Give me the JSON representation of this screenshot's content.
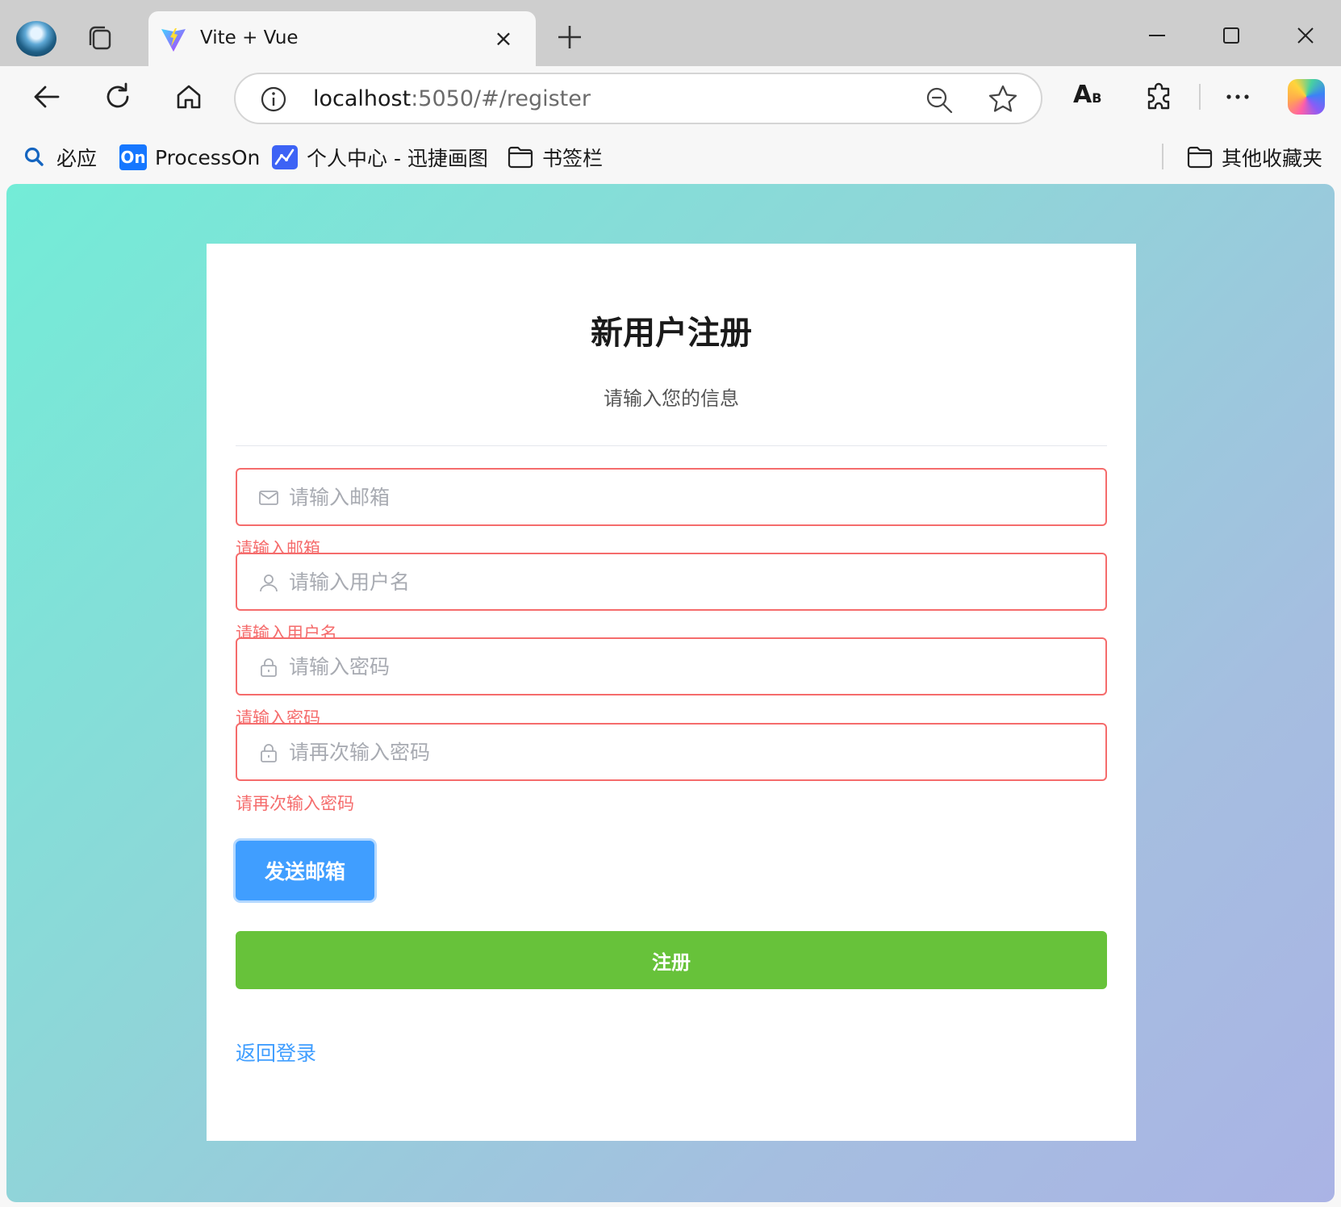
{
  "browser": {
    "tab": {
      "title": "Vite + Vue"
    },
    "address": {
      "host": "localhost",
      "rest": ":5050/#/register"
    },
    "text_size_label": "A",
    "text_size_sub": "B",
    "bookmarks": [
      {
        "label": "必应",
        "icon": "search-icon"
      },
      {
        "label": "ProcessOn",
        "icon": "processon-icon",
        "badge": "On"
      },
      {
        "label": "个人中心 - 迅捷画图",
        "icon": "chart-icon"
      },
      {
        "label": "书签栏",
        "icon": "folder-icon"
      }
    ],
    "other_bookmarks": {
      "label": "其他收藏夹",
      "icon": "folder-icon"
    }
  },
  "page": {
    "title": "新用户注册",
    "subtitle": "请输入您的信息",
    "fields": [
      {
        "icon": "mail-icon",
        "placeholder": "请输入邮箱",
        "value": "",
        "error": "请输入邮箱"
      },
      {
        "icon": "user-icon",
        "placeholder": "请输入用户名",
        "value": "",
        "error": "请输入用户名"
      },
      {
        "icon": "lock-icon",
        "placeholder": "请输入密码",
        "value": "",
        "error": "请输入密码"
      },
      {
        "icon": "lock-icon",
        "placeholder": "请再次输入密码",
        "value": "",
        "error": "请再次输入密码"
      }
    ],
    "send_email_button": "发送邮箱",
    "register_button": "注册",
    "back_to_login": "返回登录"
  },
  "colors": {
    "error": "#f56c6c",
    "primary": "#409eff",
    "success": "#67c23a",
    "gradient_start": "#73ecd7",
    "gradient_end": "#aab3e5"
  }
}
